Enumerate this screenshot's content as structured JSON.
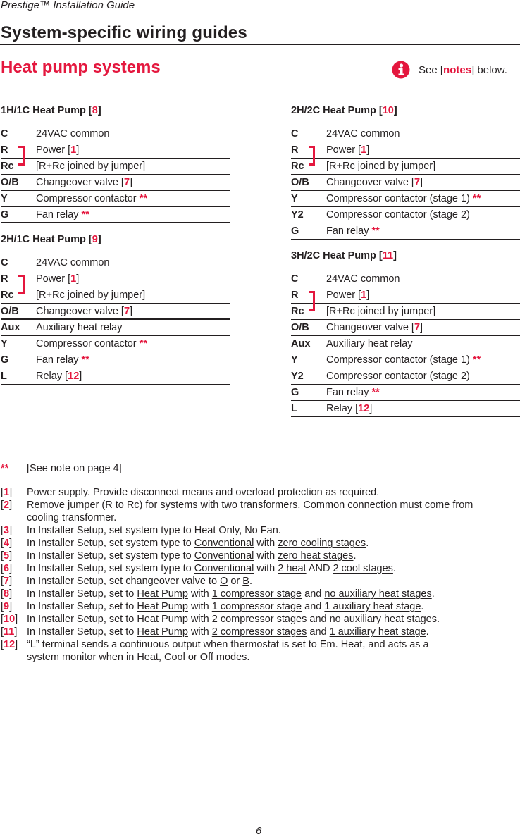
{
  "header": {
    "title": "Prestige™ Installation Guide"
  },
  "section_title": "System-specific wiring guides",
  "subsection_title": "Heat pump systems",
  "notes_ref": {
    "prefix": "See [",
    "link": "notes",
    "suffix": "] below.",
    "icon": "info-icon"
  },
  "tables": [
    {
      "name": "1H/1C Heat Pump [",
      "ref": "8",
      "name_suffix": "]",
      "rows": [
        {
          "term": "C",
          "desc": "24VAC common"
        },
        {
          "term": "R",
          "desc": "Power [",
          "ref": "1",
          "after": "]"
        },
        {
          "term": "Rc",
          "desc": "[R+Rc joined by jumper]"
        },
        {
          "term": "O/B",
          "desc": "Changeover valve [",
          "ref": "7",
          "after": "]"
        },
        {
          "term": "Y",
          "desc": "Compressor contactor ",
          "stars": "**"
        },
        {
          "term": "G",
          "desc": "Fan relay ",
          "stars": "**"
        }
      ]
    },
    {
      "name": "2H/1C Heat Pump [",
      "ref": "9",
      "name_suffix": "]",
      "rows": [
        {
          "term": "C",
          "desc": "24VAC common"
        },
        {
          "term": "R",
          "desc": "Power [",
          "ref": "1",
          "after": "]"
        },
        {
          "term": "Rc",
          "desc": "[R+Rc joined by jumper]"
        },
        {
          "term": "O/B",
          "desc": "Changeover valve [",
          "ref": "7",
          "after": "]"
        },
        {
          "term": "Aux",
          "desc": "Auxiliary heat relay"
        },
        {
          "term": "Y",
          "desc": "Compressor contactor ",
          "stars": "**"
        },
        {
          "term": "G",
          "desc": "Fan relay ",
          "stars": "**"
        },
        {
          "term": "L",
          "desc": "Relay [",
          "ref": "12",
          "after": "]"
        }
      ]
    },
    {
      "name": "2H/2C Heat Pump [",
      "ref": "10",
      "name_suffix": "]",
      "rows": [
        {
          "term": "C",
          "desc": "24VAC common"
        },
        {
          "term": "R",
          "desc": "Power [",
          "ref": "1",
          "after": "]"
        },
        {
          "term": "Rc",
          "desc": "[R+Rc joined by jumper]"
        },
        {
          "term": "O/B",
          "desc": "Changeover valve [",
          "ref": "7",
          "after": "]"
        },
        {
          "term": "Y",
          "desc": "Compressor contactor (stage 1) ",
          "stars": "**"
        },
        {
          "term": "Y2",
          "desc": "Compressor contactor (stage 2)"
        },
        {
          "term": "G",
          "desc": "Fan relay ",
          "stars": "**"
        }
      ]
    },
    {
      "name": "3H/2C Heat Pump [",
      "ref": "11",
      "name_suffix": "]",
      "rows": [
        {
          "term": "C",
          "desc": "24VAC common"
        },
        {
          "term": "R",
          "desc": "Power [",
          "ref": "1",
          "after": "]"
        },
        {
          "term": "Rc",
          "desc": "[R+Rc joined by jumper]"
        },
        {
          "term": "O/B",
          "desc": "Changeover valve [",
          "ref": "7",
          "after": "]"
        },
        {
          "term": "Aux",
          "desc": "Auxiliary heat relay"
        },
        {
          "term": "Y",
          "desc": "Compressor contactor (stage 1) ",
          "stars": "**"
        },
        {
          "term": "Y2",
          "desc": "Compressor contactor (stage 2)"
        },
        {
          "term": "G",
          "desc": "Fan relay ",
          "stars": "**"
        },
        {
          "term": "L",
          "desc": "Relay [",
          "ref": "12",
          "after": "]"
        }
      ]
    }
  ],
  "notes": {
    "star_note": {
      "mark": "**",
      "text": "[See note on page 4]"
    },
    "items": [
      {
        "num": "1",
        "parts": [
          {
            "t": "Power supply. Provide disconnect means and overload protection as required."
          }
        ]
      },
      {
        "num": "2",
        "parts": [
          {
            "t": "Remove jumper (R to Rc) for systems with two transformers. Common connection must come from cooling transformer."
          }
        ]
      },
      {
        "num": "3",
        "parts": [
          {
            "t": "In Installer Setup, set  system type to "
          },
          {
            "u": "Heat Only, No Fan"
          },
          {
            "t": "."
          }
        ]
      },
      {
        "num": "4",
        "parts": [
          {
            "t": "In Installer Setup, set  system type to "
          },
          {
            "u": "Conventional"
          },
          {
            "t": " with "
          },
          {
            "u": "zero cooling stages"
          },
          {
            "t": "."
          }
        ]
      },
      {
        "num": "5",
        "parts": [
          {
            "t": "In Installer Setup, set  system type to "
          },
          {
            "u": "Conventional"
          },
          {
            "t": " with "
          },
          {
            "u": "zero heat stages"
          },
          {
            "t": "."
          }
        ]
      },
      {
        "num": "6",
        "parts": [
          {
            "t": "In Installer Setup, set  system type to "
          },
          {
            "u": "Conventional"
          },
          {
            "t": " with "
          },
          {
            "u": "2 heat"
          },
          {
            "t": " AND "
          },
          {
            "u": "2 cool stages"
          },
          {
            "t": "."
          }
        ]
      },
      {
        "num": "7",
        "parts": [
          {
            "t": "In Installer Setup, set changeover valve to "
          },
          {
            "u": "O"
          },
          {
            "t": " or "
          },
          {
            "u": "B"
          },
          {
            "t": "."
          }
        ]
      },
      {
        "num": "8",
        "parts": [
          {
            "t": "In Installer Setup, set to "
          },
          {
            "u": "Heat Pump"
          },
          {
            "t": " with "
          },
          {
            "u": "1 compressor stage"
          },
          {
            "t": " and "
          },
          {
            "u": "no auxiliary heat stages"
          },
          {
            "t": "."
          }
        ]
      },
      {
        "num": "9",
        "parts": [
          {
            "t": "In Installer Setup, set to "
          },
          {
            "u": "Heat Pump"
          },
          {
            "t": " with "
          },
          {
            "u": "1 compressor stage"
          },
          {
            "t": " and "
          },
          {
            "u": "1 auxiliary heat stage"
          },
          {
            "t": "."
          }
        ]
      },
      {
        "num": "10",
        "parts": [
          {
            "t": "In Installer Setup, set to "
          },
          {
            "u": "Heat Pump"
          },
          {
            "t": " with "
          },
          {
            "u": "2 compressor stages"
          },
          {
            "t": " and "
          },
          {
            "u": "no auxiliary heat stages"
          },
          {
            "t": "."
          }
        ]
      },
      {
        "num": "11",
        "parts": [
          {
            "t": "In Installer Setup, set to "
          },
          {
            "u": "Heat Pump"
          },
          {
            "t": " with "
          },
          {
            "u": "2 compressor stages"
          },
          {
            "t": " and "
          },
          {
            "u": "1 auxiliary heat stage"
          },
          {
            "t": "."
          }
        ]
      },
      {
        "num": "12",
        "parts": [
          {
            "t": "“L” terminal sends a continuous output when thermostat is set to Em. Heat, and acts as a system monitor when in Heat, Cool or Off modes."
          }
        ]
      }
    ]
  },
  "page_number": "6"
}
